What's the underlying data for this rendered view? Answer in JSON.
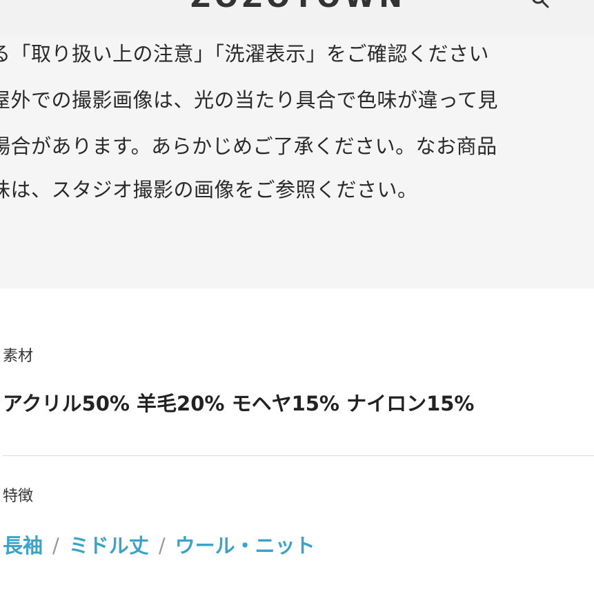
{
  "header": {
    "logo_text": "ZOZOTOWN",
    "search_icon": "search-icon"
  },
  "notice": {
    "lines": [
      "る「取り扱い上の注意」「洗濯表示」をご確認ください",
      "屋外での撮影画像は、光の当たり具合で色味が違って見",
      "場合があります。あらかじめご了承ください。なお商品",
      "味は、スタジオ撮影の画像をご参照ください。"
    ]
  },
  "material": {
    "label": "素材",
    "value": "アクリル50% 羊毛20% モヘヤ15% ナイロン15%"
  },
  "features": {
    "label": "特徴",
    "items": [
      "長袖",
      "ミドル丈",
      "ウール・ニット"
    ],
    "separator": "/"
  },
  "colors": {
    "link": "#3ba3c8",
    "notice_bg": "#f5f5f5",
    "header_bg": "#f2f2f2",
    "divider": "#dddddd"
  }
}
